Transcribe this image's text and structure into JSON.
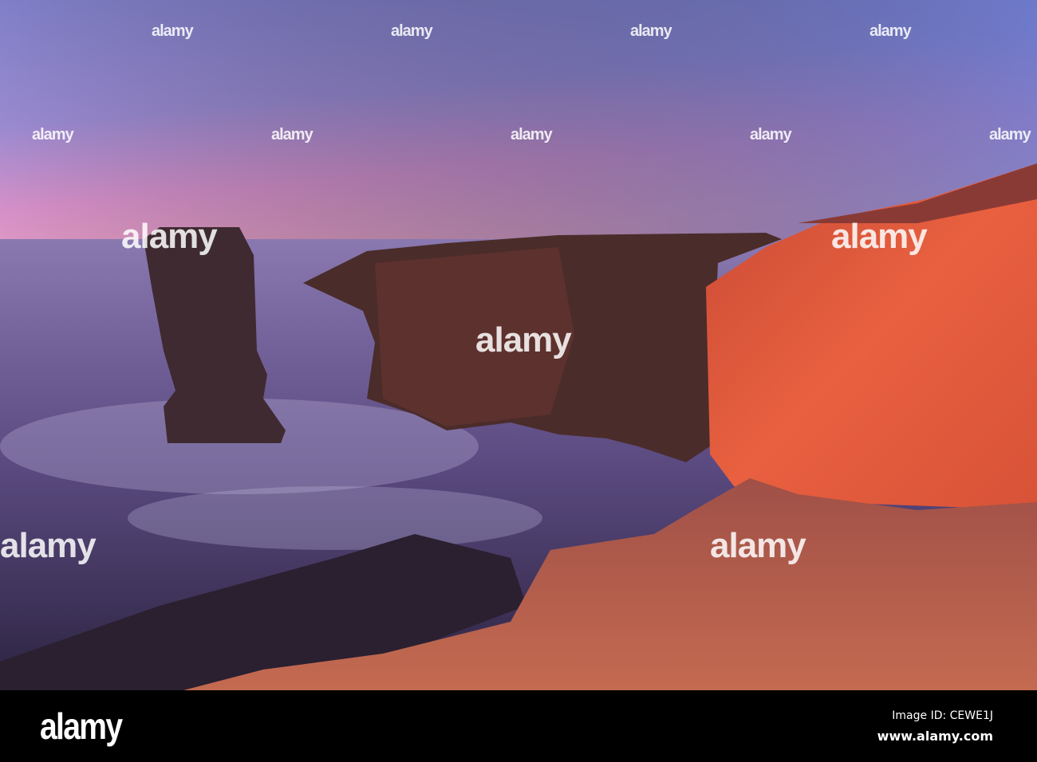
{
  "photo": {
    "subject": "Sea stack and red sandstone cliffs at sunset",
    "colors": {
      "sky_top": "#6f7fc9",
      "sky_pink": "#d98fc4",
      "sea": "#5a4a80",
      "cliff_lit": "#e0553a",
      "cliff_dark": "#4a2a28",
      "grass": "#b8604a"
    }
  },
  "watermark": {
    "text": "alamy"
  },
  "footer": {
    "logo": "alamy",
    "image_id": "Image ID: CEWE1J",
    "website": "www.alamy.com"
  }
}
